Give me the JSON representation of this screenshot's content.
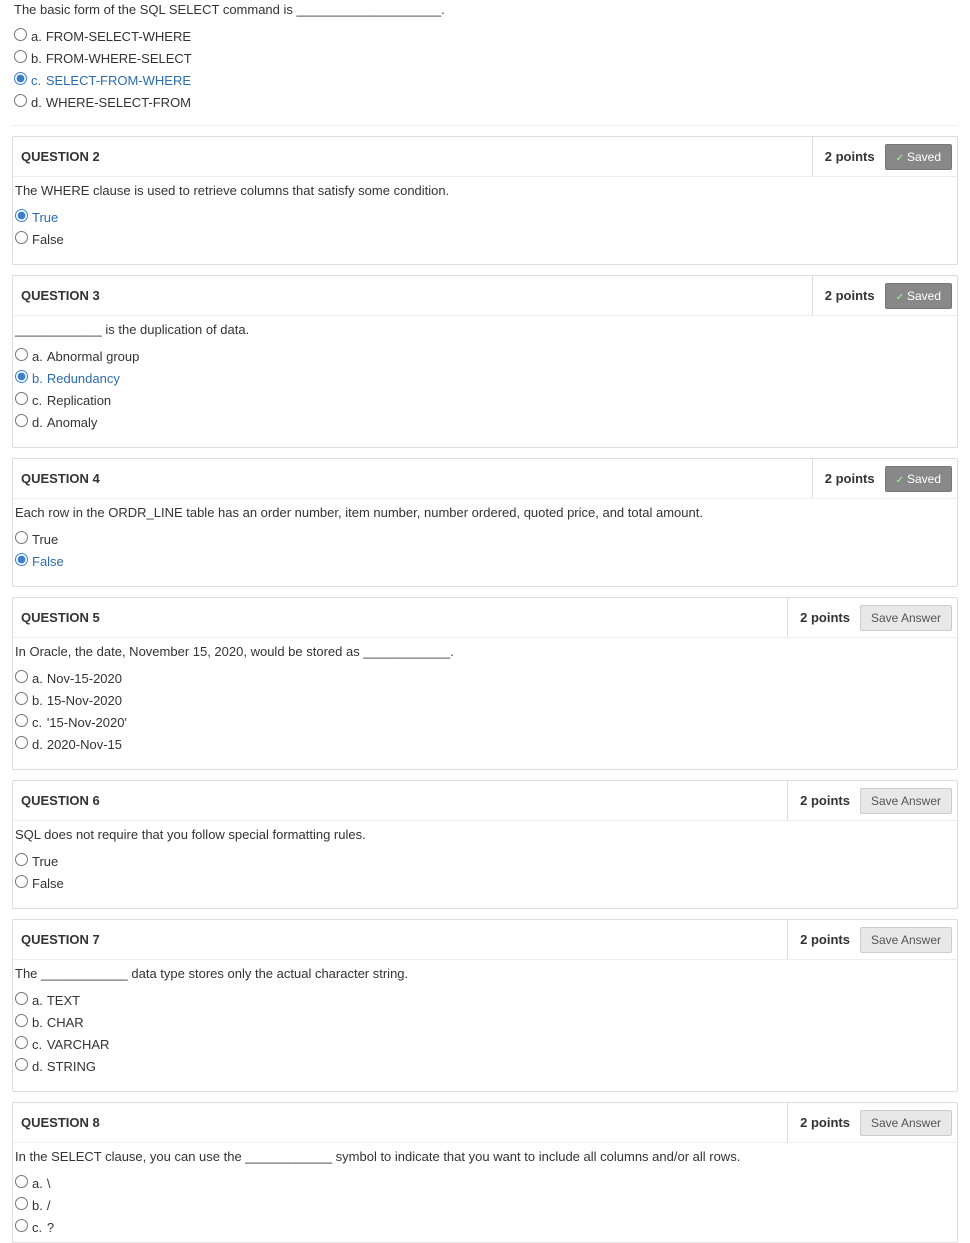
{
  "q1": {
    "prompt": "The basic form of the SQL SELECT command is ____________________.",
    "a": "FROM-SELECT-WHERE",
    "b": "FROM-WHERE-SELECT",
    "c": "SELECT-FROM-WHERE",
    "d": "WHERE-SELECT-FROM"
  },
  "q2": {
    "title": "QUESTION 2",
    "points": "2 points",
    "saved": "Saved",
    "prompt": "The WHERE clause is used to retrieve columns that satisfy some condition.",
    "t": "True",
    "f": "False"
  },
  "q3": {
    "title": "QUESTION 3",
    "points": "2 points",
    "saved": "Saved",
    "prompt": "____________ is the duplication of data.",
    "a": "Abnormal group",
    "b": "Redundancy",
    "c": "Replication",
    "d": "Anomaly"
  },
  "q4": {
    "title": "QUESTION 4",
    "points": "2 points",
    "saved": "Saved",
    "prompt": "Each row in the ORDR_LINE table has an order number, item number, number ordered, quoted price, and total amount.",
    "t": "True",
    "f": "False"
  },
  "q5": {
    "title": "QUESTION 5",
    "points": "2 points",
    "save": "Save Answer",
    "prompt": "In Oracle, the date, November 15, 2020, would be stored as ____________.",
    "a": "Nov-15-2020",
    "b": "15-Nov-2020",
    "c": "'15-Nov-2020'",
    "d": "2020-Nov-15"
  },
  "q6": {
    "title": "QUESTION 6",
    "points": "2 points",
    "save": "Save Answer",
    "prompt": "SQL does not require that you follow special formatting rules.",
    "t": "True",
    "f": "False"
  },
  "q7": {
    "title": "QUESTION 7",
    "points": "2 points",
    "save": "Save Answer",
    "prompt": "The ____________ data type stores only the actual character string.",
    "a": "TEXT",
    "b": "CHAR",
    "c": "VARCHAR",
    "d": "STRING"
  },
  "q8": {
    "title": "QUESTION 8",
    "points": "2 points",
    "save": "Save Answer",
    "prompt": "In the SELECT clause, you can use the ____________ symbol to indicate that you want to include all columns and/or all rows.",
    "a": "\\",
    "b": "/",
    "c": "?"
  },
  "letters": {
    "a": "a.",
    "b": "b.",
    "c": "c.",
    "d": "d."
  }
}
